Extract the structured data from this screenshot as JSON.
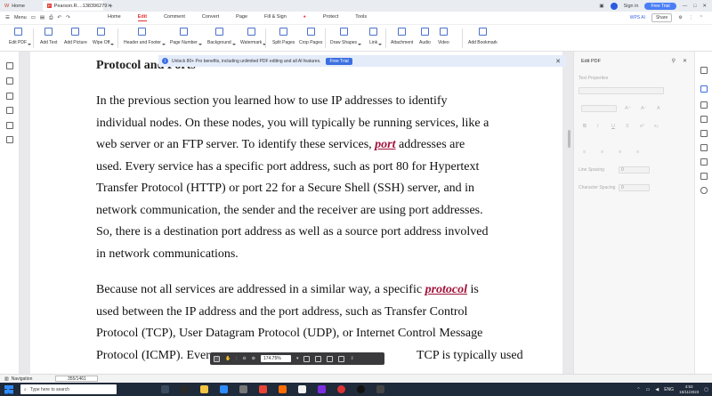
{
  "window": {
    "home_tab": "Home",
    "doc_tab": "Pearson.R....138396279",
    "sign_in": "Sign in",
    "free_trial": "Free Trial"
  },
  "menu": {
    "menu_label": "Menu",
    "items": [
      "Home",
      "Edit",
      "Comment",
      "Convert",
      "Page",
      "Fill & Sign",
      "Protect",
      "Tools"
    ],
    "active": "Edit",
    "wps_ai": "WPS AI",
    "share": "Share"
  },
  "ribbon": {
    "buttons": [
      "Edit PDF",
      "Add Text",
      "Add Picture",
      "Wipe Off",
      "Header and Footer",
      "Page Number",
      "Background",
      "Watermark",
      "Split Pages",
      "Crop Pages",
      "Draw Shapes",
      "Link",
      "Attachment",
      "Audio",
      "Video",
      "Add Bookmark"
    ]
  },
  "banner": {
    "text": "Unlock 80+ Pro benefits, including unlimited PDF editing and all AI features.",
    "button": "Free Trial"
  },
  "document": {
    "heading": "Protocol and Ports",
    "para1": [
      {
        "pre": "In the previous section you learned how to use IP addresses to identify"
      },
      {
        "pre": "individual nodes. On these nodes, you will typically be running services, like a"
      },
      {
        "pre": "web server or an FTP server. To identify these services, ",
        "kw": "port",
        "post": " addresses are"
      },
      {
        "pre": "used. Every service has a specific port address, such as port 80 for Hypertext"
      },
      {
        "pre": "Transfer Protocol (HTTP) or port 22 for a Secure Shell (SSH) server, and in"
      },
      {
        "pre": "network communication, the sender and the receiver are using port addresses."
      },
      {
        "pre": "So, there is a destination port address as well as a source port address involved"
      },
      {
        "pre": "in network communications."
      }
    ],
    "para2": [
      {
        "pre": "Because not all services are addressed in a similar way, a specific ",
        "kw": "protocol",
        "post": " is"
      },
      {
        "pre": "used between the IP address and the port address, such as Transfer Control"
      },
      {
        "pre": "Protocol (TCP), User Datagram Protocol (UDP), or Internet Control Message"
      },
      {
        "pre": "Protocol (ICMP). Ever",
        "post": "TCP is typically used"
      }
    ]
  },
  "float_toolbar": {
    "zoom": "174.75%"
  },
  "right_panel": {
    "title": "Edit PDF",
    "text_properties": "Text Properties",
    "line_spacing": "Line Spacing",
    "line_spacing_value": "0",
    "char_spacing": "Character Spacing",
    "char_spacing_value": "0"
  },
  "status": {
    "navigation": "Navigation",
    "page_indicator": "355/1461"
  },
  "taskbar": {
    "search_placeholder": "Type here to search",
    "lang": "ENG",
    "time": "4:53",
    "date": "15/11/2023"
  }
}
